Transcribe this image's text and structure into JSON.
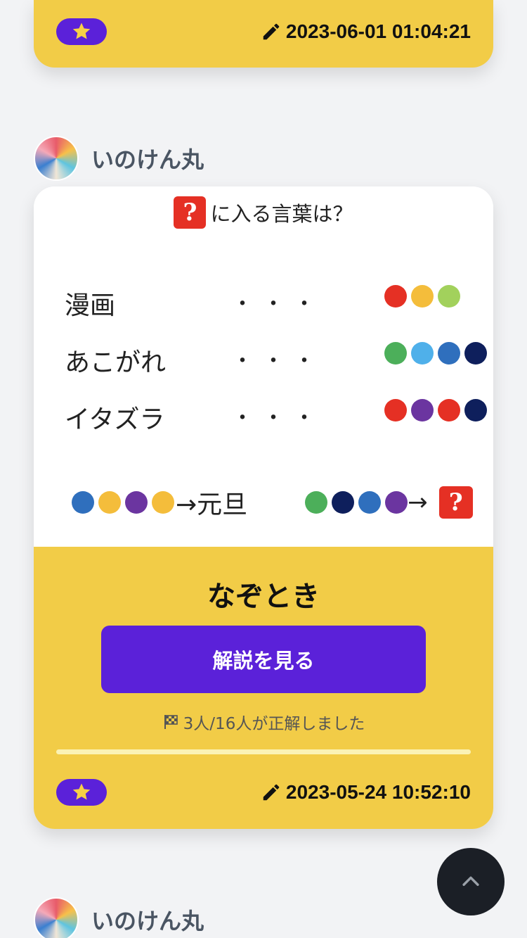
{
  "prev_post": {
    "timestamp": "2023-06-01 01:04:21"
  },
  "post": {
    "author": "いのけん丸",
    "puzzle": {
      "prompt_text": "に入る言葉は？",
      "question_mark": "?",
      "dots": "・・・",
      "rows": [
        {
          "word": "漫画",
          "circles": [
            "#e53024",
            "#f4bd3b",
            "#a2d15c"
          ]
        },
        {
          "word": "あこがれ",
          "circles": [
            "#4caf5a",
            "#4fb0ea",
            "#2f6fbd",
            "#0e1f5c"
          ]
        },
        {
          "word": "イタズラ",
          "circles": [
            "#e53024",
            "#6b35a0",
            "#e53024",
            "#0e1f5c"
          ]
        }
      ],
      "example": {
        "circles": [
          "#2f6fbd",
          "#f4bd3b",
          "#6b35a0",
          "#f4bd3b"
        ],
        "answer": "→元旦"
      },
      "question": {
        "circles": [
          "#4caf5a",
          "#0e1f5c",
          "#2f6fbd",
          "#6b35a0"
        ],
        "arrow": "→"
      }
    },
    "category": "なぞとき",
    "solve_button": "解説を見る",
    "stats": "3人/16人が正解しました",
    "timestamp": "2023-05-24 10:52:10"
  },
  "next_post": {
    "author": "いのけん丸"
  },
  "icons": {
    "star": "star-icon",
    "pencil": "pencil-icon",
    "flag": "checkered-flag-icon",
    "scroll_top": "chevron-up-icon"
  },
  "colors": {
    "card_yellow": "#f2cc47",
    "accent_purple": "#5b21d9",
    "star_yellow": "#f7d046"
  }
}
